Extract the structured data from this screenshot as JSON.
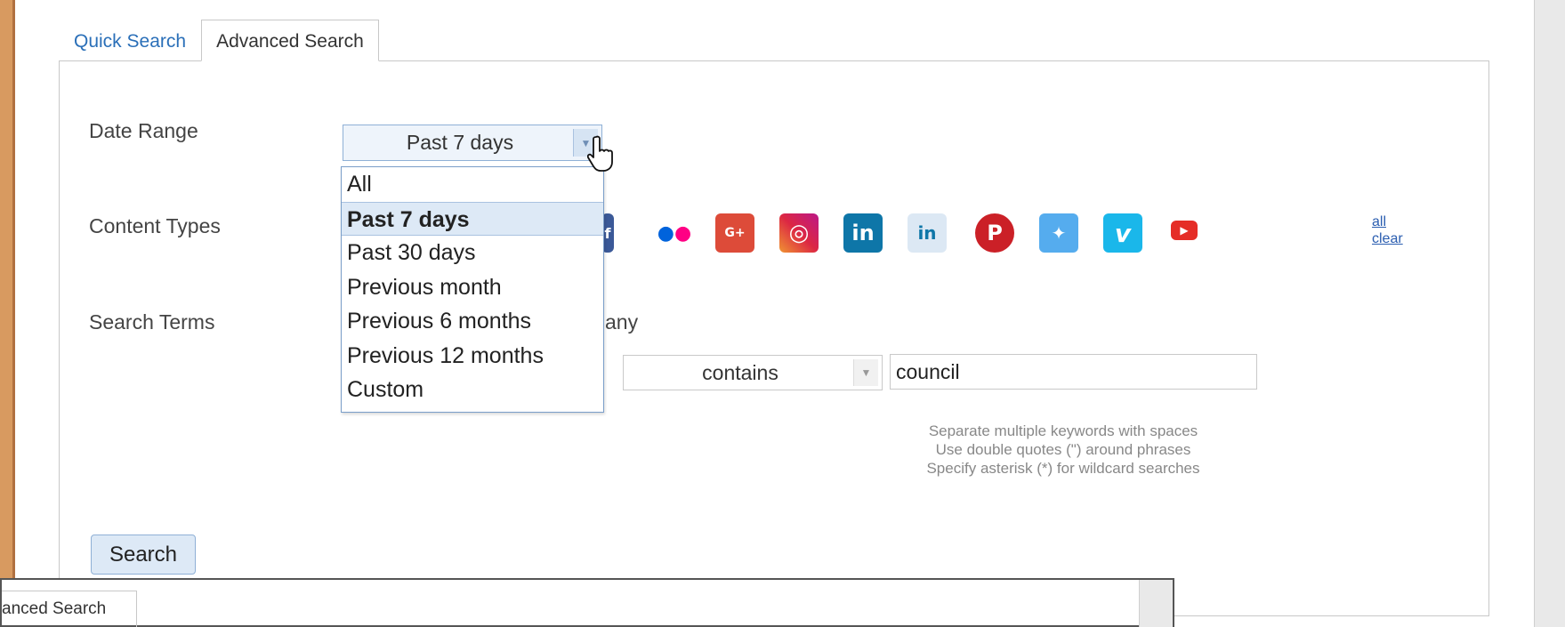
{
  "tabs": {
    "quick_search": "Quick Search",
    "advanced_search": "Advanced Search"
  },
  "form": {
    "date_range_label": "Date Range",
    "date_range_value": "Past 7 days",
    "content_types_label": "Content Types",
    "search_terms_label": "Search Terms",
    "match_any_partial": "any",
    "condition_value": "contains",
    "keyword_value": "council"
  },
  "date_options": [
    "All",
    "Past 7 days",
    "Past 30 days",
    "Previous month",
    "Previous 6 months",
    "Previous 12 months",
    "Custom"
  ],
  "selected_option_index": 1,
  "content_type_icons": [
    {
      "name": "facebook-icon",
      "color": "#3b5998",
      "glyph": "f"
    },
    {
      "name": "flickr-icon",
      "color": "#ffffff",
      "glyph": "●●"
    },
    {
      "name": "google-plus-icon",
      "color": "#dd4b39",
      "glyph": "G+"
    },
    {
      "name": "instagram-icon",
      "color": "#c13584",
      "glyph": "◎"
    },
    {
      "name": "linkedin-icon",
      "color": "#0e76a8",
      "glyph": "in"
    },
    {
      "name": "linkedin-pages-icon",
      "color": "#0e76a8",
      "glyph": "in"
    },
    {
      "name": "pinterest-icon",
      "color": "#cb2027",
      "glyph": "P"
    },
    {
      "name": "twitter-icon",
      "color": "#55acee",
      "glyph": "🐦"
    },
    {
      "name": "vimeo-icon",
      "color": "#1ab7ea",
      "glyph": "v"
    },
    {
      "name": "youtube-icon",
      "color": "#e52d27",
      "glyph": "▶"
    }
  ],
  "links": {
    "all": "all",
    "clear": "clear"
  },
  "hints": [
    "Separate multiple keywords with spaces",
    "Use double quotes (\") around phrases",
    "Specify asterisk (*) for wildcard searches"
  ],
  "search_button": "Search",
  "overlay": {
    "tab_label": "anced Search"
  }
}
